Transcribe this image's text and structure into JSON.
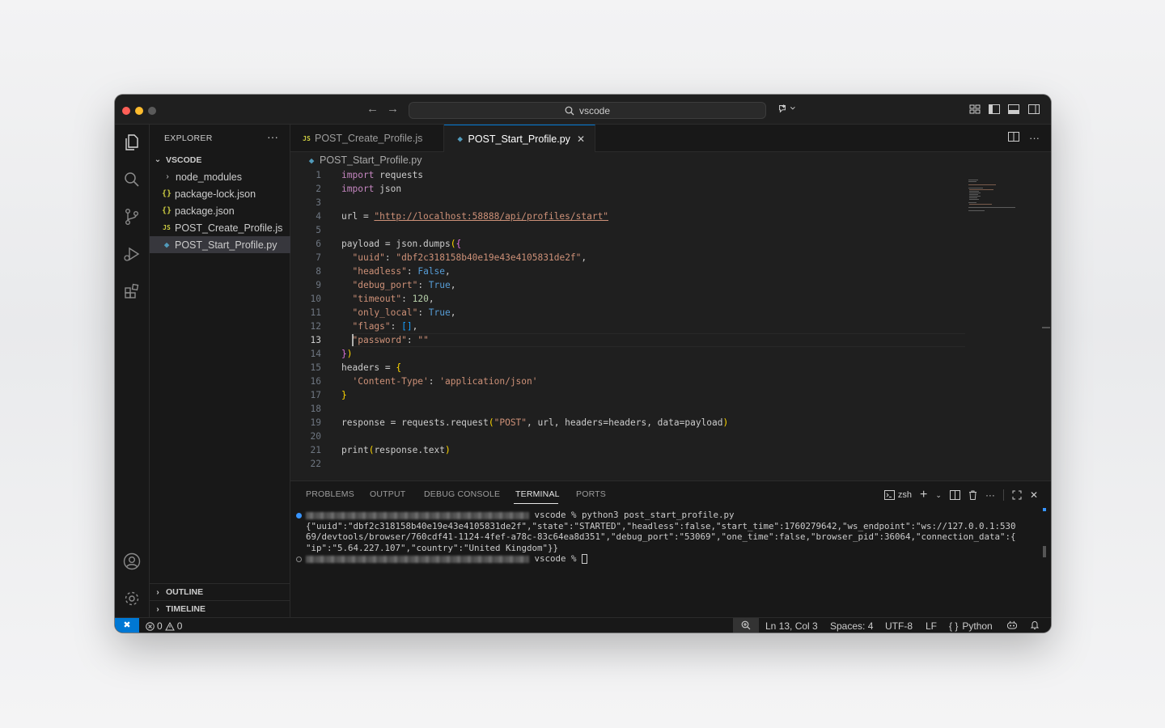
{
  "titlebar": {
    "search_text": "vscode"
  },
  "sidebar": {
    "title": "EXPLORER",
    "root_folder": "VSCODE",
    "items": [
      {
        "label": "node_modules",
        "type": "folder"
      },
      {
        "label": "package-lock.json",
        "type": "json"
      },
      {
        "label": "package.json",
        "type": "json"
      },
      {
        "label": "POST_Create_Profile.js",
        "type": "js"
      },
      {
        "label": "POST_Start_Profile.py",
        "type": "py",
        "selected": true
      }
    ],
    "outline": "OUTLINE",
    "timeline": "TIMELINE"
  },
  "tabs": [
    {
      "label": "POST_Create_Profile.js",
      "icon": "js",
      "active": false
    },
    {
      "label": "POST_Start_Profile.py",
      "icon": "py",
      "active": true
    }
  ],
  "breadcrumb": "POST_Start_Profile.py",
  "editor": {
    "current_line": 13,
    "line_numbers": [
      "1",
      "2",
      "3",
      "4",
      "5",
      "6",
      "7",
      "8",
      "9",
      "10",
      "11",
      "12",
      "13",
      "14",
      "15",
      "16",
      "17",
      "18",
      "19",
      "20",
      "21",
      "22"
    ]
  },
  "panel": {
    "tabs": [
      "PROBLEMS",
      "OUTPUT",
      "DEBUG CONSOLE",
      "TERMINAL",
      "PORTS"
    ],
    "active_tab": "TERMINAL",
    "shell": "zsh",
    "terminal": {
      "prompt_dir": "vscode %",
      "command": "python3 post_start_profile.py",
      "output_lines": [
        "{\"uuid\":\"dbf2c318158b40e19e43e4105831de2f\",\"state\":\"STARTED\",\"headless\":false,\"start_time\":1760279642,\"ws_endpoint\":\"ws://127.0.0.1:530",
        "69/devtools/browser/760cdf41-1124-4fef-a78c-83c64ea8d351\",\"debug_port\":\"53069\",\"one_time\":false,\"browser_pid\":36064,\"connection_data\":{",
        "\"ip\":\"5.64.227.107\",\"country\":\"United Kingdom\"}}"
      ]
    }
  },
  "statusbar": {
    "errors": "0",
    "warnings": "0",
    "position": "Ln 13, Col 3",
    "spaces": "Spaces: 4",
    "encoding": "UTF-8",
    "eol": "LF",
    "language": "Python"
  },
  "colors": {
    "accent": "#0078d4",
    "editor_bg": "#1f1f1f",
    "sidebar_bg": "#181818"
  }
}
